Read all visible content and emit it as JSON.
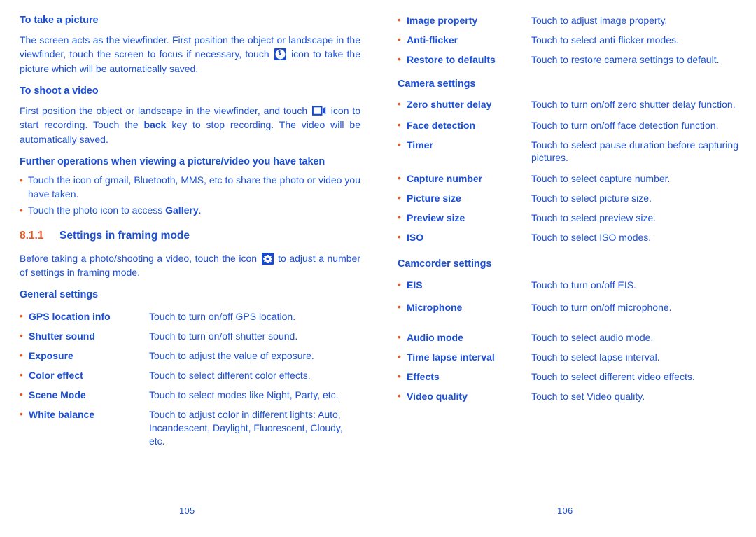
{
  "document": {
    "left_page_number": "105",
    "right_page_number": "106"
  },
  "colors": {
    "blue": "#1B4FD6",
    "orange": "#E8551E",
    "icon_bg": "#1948D0"
  },
  "left_column": {
    "heading_take_picture": "To take a picture",
    "para_take_picture_1": "The screen acts as the viewfinder. First position the object or landscape in the viewfinder, touch the screen to focus if necessary, touch ",
    "para_take_picture_2": " icon to take the picture which will be automatically saved.",
    "heading_shoot_video": "To shoot a video",
    "para_shoot_video_1": "First position the object or landscape in the viewfinder, and touch ",
    "para_shoot_video_2": " icon to start recording. Touch the ",
    "para_shoot_video_bold": "back",
    "para_shoot_video_3": " key to stop recording. The video will be automatically saved.",
    "heading_further_ops": "Further operations when viewing a picture/video you have taken",
    "bullets": [
      {
        "text": "Touch the icon of gmail, Bluetooth, MMS, etc to share the photo or video you have taken."
      }
    ],
    "bullet_gallery_pre": "Touch the photo icon to access ",
    "bullet_gallery_bold": "Gallery",
    "bullet_gallery_post": ".",
    "section_number": "8.1.1",
    "section_title": "Settings in framing mode",
    "para_framing_1": "Before taking a photo/shooting a video, touch the icon ",
    "para_framing_2": " to adjust a number of settings  in framing mode.",
    "heading_general_settings": "General settings",
    "general_settings": [
      {
        "term": "GPS location info",
        "desc": "Touch to turn on/off GPS location."
      },
      {
        "term": "Shutter sound",
        "desc": "Touch to turn on/off shutter sound."
      },
      {
        "term": "Exposure",
        "desc": "Touch to adjust the value of exposure."
      },
      {
        "term": "Color effect",
        "desc": "Touch to select different color effects."
      },
      {
        "term": "Scene Mode",
        "desc": "Touch to select modes like Night, Party, etc."
      },
      {
        "term": "White balance",
        "desc": "Touch to adjust color in different lights: Auto, Incandescent, Daylight, Fluorescent, Cloudy, etc."
      }
    ]
  },
  "right_column": {
    "general_settings_cont": [
      {
        "term": "Image property",
        "desc": "Touch to adjust image property."
      },
      {
        "term": "Anti-flicker",
        "desc": "Touch to select anti-flicker modes."
      },
      {
        "term": "Restore to defaults",
        "desc": "Touch to restore camera settings to default."
      }
    ],
    "heading_camera_settings": "Camera settings",
    "camera_settings": [
      {
        "term": "Zero shutter delay",
        "desc": "Touch to turn on/off  zero shutter delay function.",
        "justify": false
      },
      {
        "term": "Face detection",
        "desc": "Touch to turn on/off face detection function.",
        "justify": false
      },
      {
        "term": "Timer",
        "desc": "Touch to select pause duration before capturing pictures.",
        "justify": true
      },
      {
        "term": "Capture number",
        "desc": "Touch to select capture number.",
        "justify": false
      },
      {
        "term": "Picture size",
        "desc": "Touch to select picture size.",
        "justify": false
      },
      {
        "term": "Preview size",
        "desc": "Touch to select preview size.",
        "justify": false
      },
      {
        "term": " ISO",
        "desc": "Touch to select ISO modes.",
        "justify": false
      }
    ],
    "heading_camcorder_settings": "Camcorder settings",
    "camcorder_settings_a": [
      {
        "term": "EIS",
        "desc": "Touch to turn on/off EIS."
      },
      {
        "term": "Microphone",
        "desc": "Touch to turn on/off microphone."
      }
    ],
    "camcorder_settings_b": [
      {
        "term": "Audio mode",
        "desc": "Touch to select audio mode."
      },
      {
        "term": "Time lapse interval",
        "desc": "Touch to select lapse interval."
      },
      {
        "term": "Effects",
        "desc": "Touch to select different video effects."
      },
      {
        "term": "Video quality",
        "desc": "Touch to set Video quality."
      }
    ]
  },
  "icons": {
    "shutter": "camera-shutter-icon",
    "camcorder": "camcorder-icon",
    "settings": "settings-gear-icon",
    "bullet": "•"
  }
}
